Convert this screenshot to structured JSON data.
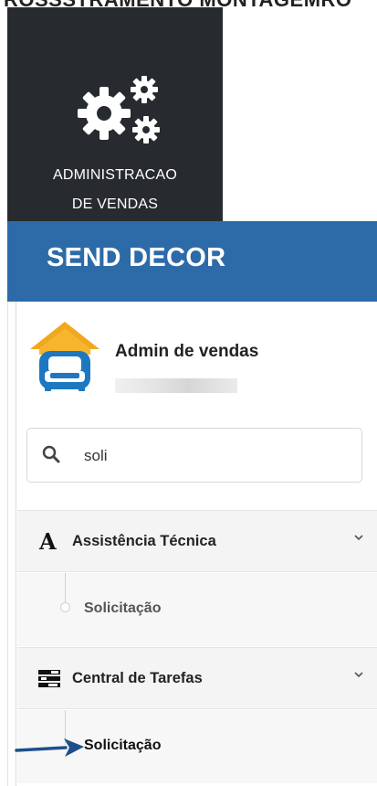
{
  "top_strip": {
    "text": "ROSSSTRAMENTO MONTAGEMRO"
  },
  "admin_tile": {
    "icon": "gears-icon",
    "label_line1": "ADMINISTRACAO",
    "label_line2": "DE VENDAS",
    "bg_color": "#272b30"
  },
  "header": {
    "brand": "SEND DECOR",
    "bg_color": "#2d6aa8"
  },
  "profile": {
    "name": "Admin de vendas",
    "avatar_icon": "armchair-house-icon"
  },
  "search": {
    "value": "soli",
    "icon": "search-icon"
  },
  "menu": {
    "groups": [
      {
        "label": "Assistência Técnica",
        "icon": "font-a-icon",
        "expanded": true,
        "children": [
          {
            "label": "Solicitação",
            "active": false
          }
        ]
      },
      {
        "label": "Central de Tarefas",
        "icon": "tasks-list-icon",
        "expanded": true,
        "children": [
          {
            "label": "Solicitação",
            "active": true
          }
        ]
      }
    ]
  },
  "annotation": {
    "icon": "arrow-right-icon",
    "color": "#1e4f8a"
  }
}
